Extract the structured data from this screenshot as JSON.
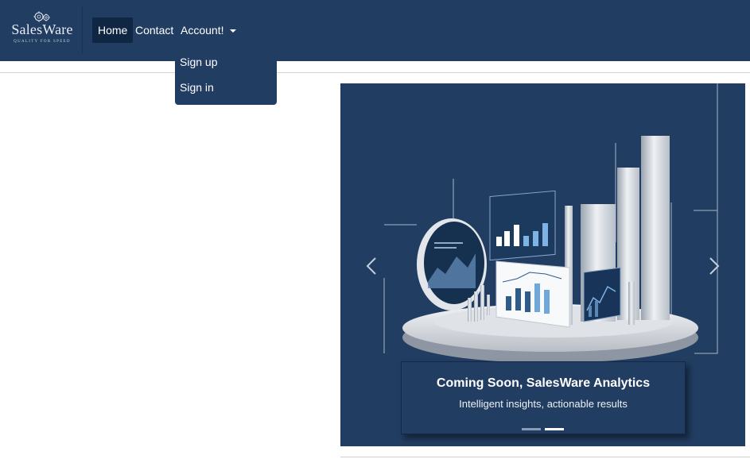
{
  "brand": {
    "name": "SalesWare",
    "tagline": "QUALITY FOR SPEED",
    "logo_icon": "gears-icon"
  },
  "nav": {
    "items": [
      {
        "label": "Home",
        "active": true
      },
      {
        "label": "Contact",
        "active": false
      },
      {
        "label": "Account!",
        "active": false,
        "has_dropdown": true
      }
    ],
    "account_menu": {
      "expanded": true,
      "items": [
        {
          "label": "Sign up"
        },
        {
          "label": "Sign in"
        }
      ]
    }
  },
  "carousel": {
    "slide_image": "3d-analytics-dashboard-illustration",
    "caption": {
      "title": "Coming Soon, SalesWare Analytics",
      "subtitle": "Intelligent insights, actionable results"
    },
    "controls": {
      "prev_icon": "chevron-left-icon",
      "next_icon": "chevron-right-icon"
    },
    "slide_count": 2,
    "active_slide": 2
  },
  "colors": {
    "primary": "#213d61",
    "active_nav": "#0f2743",
    "text_on_primary": "#ffffff"
  }
}
